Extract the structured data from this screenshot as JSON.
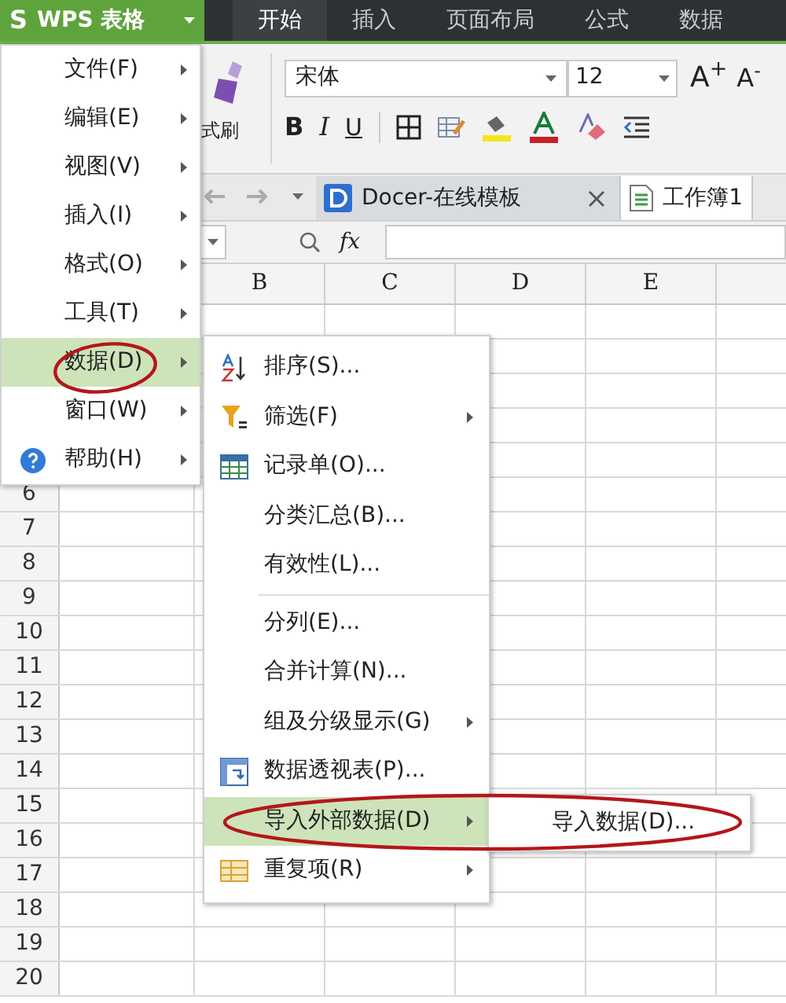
{
  "app_button": {
    "logo": "S",
    "label": "WPS 表格"
  },
  "menu_tabs": [
    {
      "label": "开始",
      "selected": true
    },
    {
      "label": "插入",
      "selected": false
    },
    {
      "label": "页面布局",
      "selected": false
    },
    {
      "label": "公式",
      "selected": false
    },
    {
      "label": "数据",
      "selected": false
    }
  ],
  "ribbon": {
    "brush_label": "式刷",
    "font": "宋体",
    "font_size": "12",
    "grow": "A$^{+}$",
    "shrink": "A$^{-}$",
    "styles": [
      "B",
      "I",
      "U"
    ]
  },
  "doc_tabs": [
    {
      "label": "Docer-在线模板",
      "selected": false,
      "kind": "docer"
    },
    {
      "label": "工作簿1",
      "selected": true,
      "kind": "book"
    }
  ],
  "formula_bar": {
    "fx": "fx"
  },
  "sheet": {
    "columns": [
      "B",
      "C",
      "D",
      "E"
    ],
    "rows": [
      "6",
      "7",
      "8",
      "9",
      "10",
      "11",
      "12",
      "13",
      "14",
      "15",
      "16",
      "17",
      "18",
      "19",
      "20"
    ]
  },
  "main_menu": [
    {
      "label": "文件(F)",
      "selected": false,
      "kind": "plain"
    },
    {
      "label": "编辑(E)",
      "selected": false,
      "kind": "plain"
    },
    {
      "label": "视图(V)",
      "selected": false,
      "kind": "plain"
    },
    {
      "label": "插入(I)",
      "selected": false,
      "kind": "plain"
    },
    {
      "label": "格式(O)",
      "selected": false,
      "kind": "plain"
    },
    {
      "label": "工具(T)",
      "selected": false,
      "kind": "plain"
    },
    {
      "label": "数据(D)",
      "selected": true,
      "kind": "plain"
    },
    {
      "label": "窗口(W)",
      "selected": false,
      "kind": "plain"
    },
    {
      "label": "帮助(H)",
      "selected": false,
      "kind": "help"
    }
  ],
  "data_menu": [
    {
      "label": "排序(S)...",
      "selected": false,
      "kind": "sort",
      "submenu": false
    },
    {
      "label": "筛选(F)",
      "selected": false,
      "kind": "filter",
      "submenu": true
    },
    {
      "label": "记录单(O)...",
      "selected": false,
      "kind": "form",
      "submenu": false
    },
    {
      "label": "分类汇总(B)...",
      "selected": false,
      "kind": "plain",
      "submenu": false
    },
    {
      "label": "有效性(L)...",
      "selected": false,
      "kind": "plain",
      "submenu": false
    },
    {
      "kind": "separator"
    },
    {
      "label": "分列(E)...",
      "selected": false,
      "kind": "plain",
      "submenu": false
    },
    {
      "label": "合并计算(N)...",
      "selected": false,
      "kind": "plain",
      "submenu": false
    },
    {
      "label": "组及分级显示(G)",
      "selected": false,
      "kind": "plain",
      "submenu": true
    },
    {
      "label": "数据透视表(P)...",
      "selected": false,
      "kind": "pivot",
      "submenu": false
    },
    {
      "label": "导入外部数据(D)",
      "selected": true,
      "kind": "plain",
      "submenu": true
    },
    {
      "label": "重复项(R)",
      "selected": false,
      "kind": "duplicates",
      "submenu": true
    }
  ],
  "import_menu": [
    {
      "label": "导入数据(D)..."
    }
  ]
}
